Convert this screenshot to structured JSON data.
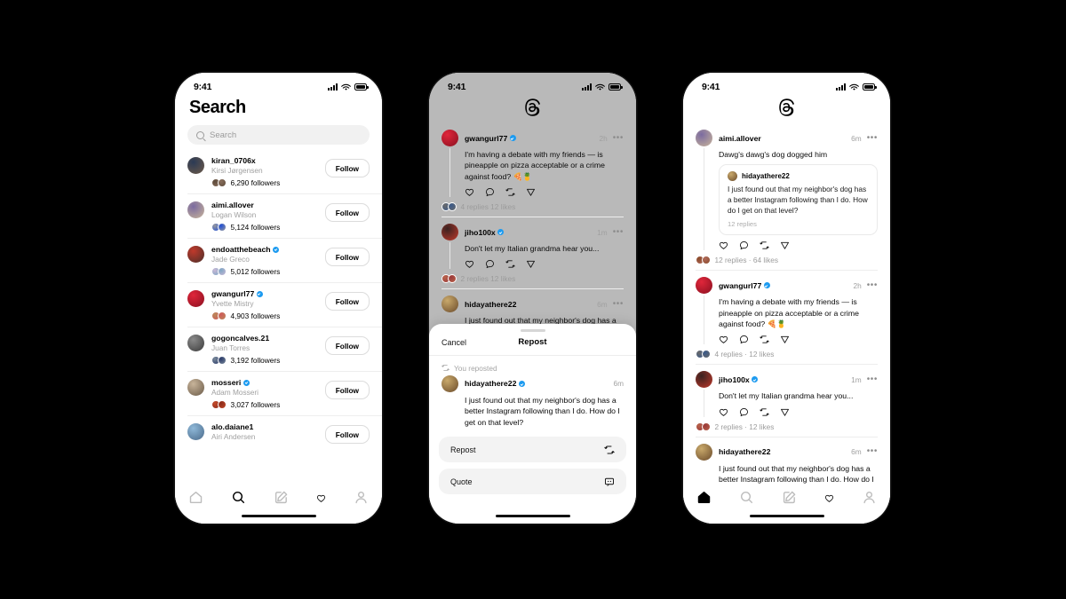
{
  "background_color": "#000000",
  "status_bar": {
    "time": "9:41",
    "icons": [
      "signal-bars",
      "wifi",
      "battery"
    ]
  },
  "phone1": {
    "title": "Search",
    "search": {
      "placeholder": "Search",
      "value": ""
    },
    "users": [
      {
        "handle": "kiran_0706x",
        "name": "Kirsi Jørgensen",
        "verified": false,
        "followers": "6,290 followers",
        "follow_label": "Follow",
        "avatar": "#2b3a55",
        "avatar2": "#6d5a48",
        "mini1": "#5c4a3a",
        "mini2": "#8a6f5c"
      },
      {
        "handle": "aimi.allover",
        "name": "Logan Wilson",
        "verified": false,
        "followers": "5,124 followers",
        "follow_label": "Follow",
        "avatar": "#7b6ba0",
        "avatar2": "#c9b59a",
        "mini1": "#9a9a9a",
        "mini2": "#1f4fd8"
      },
      {
        "handle": "endoatthebeach",
        "name": "Jade Greco",
        "verified": true,
        "followers": "5,012 followers",
        "follow_label": "Follow",
        "avatar": "#c0392b",
        "avatar2": "#4a2f2a",
        "mini1": "#c9b8d6",
        "mini2": "#7ea6c4"
      },
      {
        "handle": "gwangurl77",
        "name": "Yvette Mistry",
        "verified": true,
        "followers": "4,903 followers",
        "follow_label": "Follow",
        "avatar": "#e0263a",
        "avatar2": "#8a1020",
        "mini1": "#b98a5a",
        "mini2": "#d05a5a"
      },
      {
        "handle": "gogoncalves.21",
        "name": "Juan Torres",
        "verified": false,
        "followers": "3,192 followers",
        "follow_label": "Follow",
        "avatar": "#8a8a8a",
        "avatar2": "#3a3a3a",
        "mini1": "#7a8a9a",
        "mini2": "#2a3a6a"
      },
      {
        "handle": "mosseri",
        "name": "Adam Mosseri",
        "verified": true,
        "followers": "3,027 followers",
        "follow_label": "Follow",
        "avatar": "#c8b49a",
        "avatar2": "#6a5a48",
        "mini1": "#c44a2a",
        "mini2": "#8a2a1a"
      },
      {
        "handle": "alo.daiane1",
        "name": "Airi Andersen",
        "verified": false,
        "followers": "",
        "follow_label": "Follow",
        "avatar": "#8fb8d8",
        "avatar2": "#4a6a8a",
        "mini1": "#8fb8d8",
        "mini2": "#4a6a8a"
      }
    ],
    "tabs": [
      {
        "icon": "home-icon",
        "active": false
      },
      {
        "icon": "search-icon",
        "active": true
      },
      {
        "icon": "compose-icon",
        "active": false
      },
      {
        "icon": "heart-icon",
        "active": false
      },
      {
        "icon": "profile-icon",
        "active": false
      }
    ]
  },
  "phone2": {
    "logo": "threads-logo",
    "posts": [
      {
        "handle": "gwangurl77",
        "verified": true,
        "time": "2h",
        "text": "I'm having a debate with my friends — is pineapple on pizza acceptable or a crime against food? 🍕🍍",
        "meta": "4 replies    12 likes",
        "avatar": "#e0263a",
        "avatar2": "#8a1020",
        "actions": [
          "heart-icon",
          "comment-icon",
          "repost-icon",
          "share-icon"
        ],
        "mini1": "#6a6a6a",
        "mini2": "#3a5a8a"
      },
      {
        "handle": "jiho100x",
        "verified": true,
        "time": "1m",
        "text": "Don't let my Italian grandma hear you...",
        "meta": "2 replies    12 likes",
        "avatar": "#3a2220",
        "avatar2": "#c0392b",
        "actions": [
          "heart-icon",
          "comment-icon",
          "repost-icon",
          "share-icon"
        ],
        "mini1": "#b8624a",
        "mini2": "#9a3a3a"
      },
      {
        "handle": "hidayathere22",
        "verified": false,
        "time": "6m",
        "text": "I just found out that my neighbor's dog has a",
        "meta": "",
        "avatar": "#c9a96b",
        "avatar2": "#6a4a2a",
        "actions": [],
        "mini1": "#c9a96b",
        "mini2": "#6a4a2a"
      }
    ],
    "sheet": {
      "cancel_label": "Cancel",
      "title": "Repost",
      "reposted_flag": "You reposted",
      "post": {
        "handle": "hidayathere22",
        "verified": true,
        "time": "6m",
        "text": "I just found out that my neighbor's dog has a better Instagram following than I do. How do I get on that level?",
        "avatar": "#c9a96b",
        "avatar2": "#6a4a2a"
      },
      "options": [
        {
          "label": "Repost",
          "icon": "repost-icon"
        },
        {
          "label": "Quote",
          "icon": "quote-icon"
        }
      ]
    }
  },
  "phone3": {
    "logo": "threads-logo",
    "posts": [
      {
        "handle": "aimi.allover",
        "verified": false,
        "time": "6m",
        "text": "Dawg's dawg's dog dogged him",
        "avatar": "#7b6ba0",
        "avatar2": "#c9b59a",
        "quote": {
          "handle": "hidayathere22",
          "text": "I just found out that my neighbor's dog has a better Instagram following than I do. How do I get on that level?",
          "meta": "12 replies",
          "avatar": "#c9a96b",
          "avatar2": "#6a4a2a"
        },
        "meta": "12 replies · 64 likes",
        "actions": [
          "heart-icon",
          "comment-icon",
          "repost-icon",
          "share-icon"
        ],
        "mini1": "#8a4a2a",
        "mini2": "#b06a5a"
      },
      {
        "handle": "gwangurl77",
        "verified": true,
        "time": "2h",
        "text": "I'm having a debate with my friends — is pineapple on pizza acceptable or a crime against food? 🍕🍍",
        "avatar": "#e0263a",
        "avatar2": "#8a1020",
        "meta": "4 replies · 12 likes",
        "actions": [
          "heart-icon",
          "comment-icon",
          "repost-icon",
          "share-icon"
        ],
        "mini1": "#6a6a6a",
        "mini2": "#3a5a8a"
      },
      {
        "handle": "jiho100x",
        "verified": true,
        "time": "1m",
        "text": "Don't let my Italian grandma hear you...",
        "avatar": "#3a2220",
        "avatar2": "#c0392b",
        "meta": "2 replies · 12 likes",
        "actions": [
          "heart-icon",
          "comment-icon",
          "repost-icon",
          "share-icon"
        ],
        "mini1": "#b8624a",
        "mini2": "#9a3a3a"
      },
      {
        "handle": "hidayathere22",
        "verified": false,
        "time": "6m",
        "text": "I just found out that my neighbor's dog has a better Instagram following than I do. How do I",
        "avatar": "#c9a96b",
        "avatar2": "#6a4a2a",
        "meta": "",
        "actions": [],
        "mini1": "#c9a96b",
        "mini2": "#6a4a2a"
      }
    ],
    "tabs": [
      {
        "icon": "home-icon",
        "active": true
      },
      {
        "icon": "search-icon",
        "active": false
      },
      {
        "icon": "compose-icon",
        "active": false
      },
      {
        "icon": "heart-icon",
        "active": false
      },
      {
        "icon": "profile-icon",
        "active": false
      }
    ]
  }
}
